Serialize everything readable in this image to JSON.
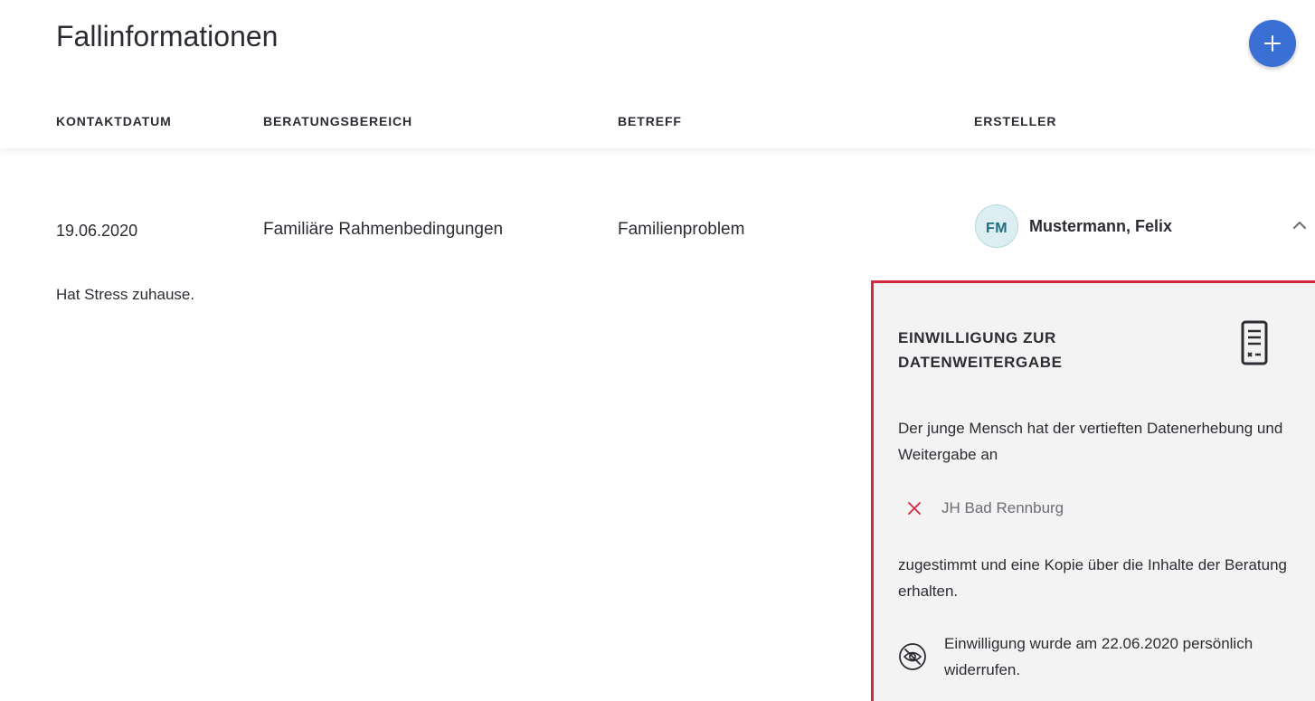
{
  "header": {
    "title": "Fallinformationen",
    "add_button_icon": "plus-icon",
    "accent_color": "#3a6fd3"
  },
  "table": {
    "columns": [
      "KONTAKTDATUM",
      "BERATUNGSBEREICH",
      "BETREFF",
      "ERSTELLER"
    ],
    "rows": [
      {
        "kontaktdatum": "19.06.2020",
        "beratungsbereich": "Familiäre Rahmenbedingungen",
        "betreff": "Familienproblem",
        "ersteller_initials": "FM",
        "ersteller_name": "Mustermann, Felix",
        "expanded": true,
        "note": "Hat Stress zuhause."
      }
    ]
  },
  "consent": {
    "title": "EINWILLIGUNG ZUR DATENWEITERGABE",
    "icon": "document-icon",
    "text_before": "Der junge Mensch hat der vertieften Datenerhebung und Weitergabe an",
    "recipient": "JH Bad Rennburg",
    "recipient_status_icon": "x-icon",
    "text_after": "zugestimmt und eine Kopie über die Inhalte der Beratung erhalten.",
    "revoked_icon": "eye-off-icon",
    "revoked_text": "Einwilligung wurde am 22.06.2020 persönlich widerrufen.",
    "border_color": "#d3283f"
  }
}
